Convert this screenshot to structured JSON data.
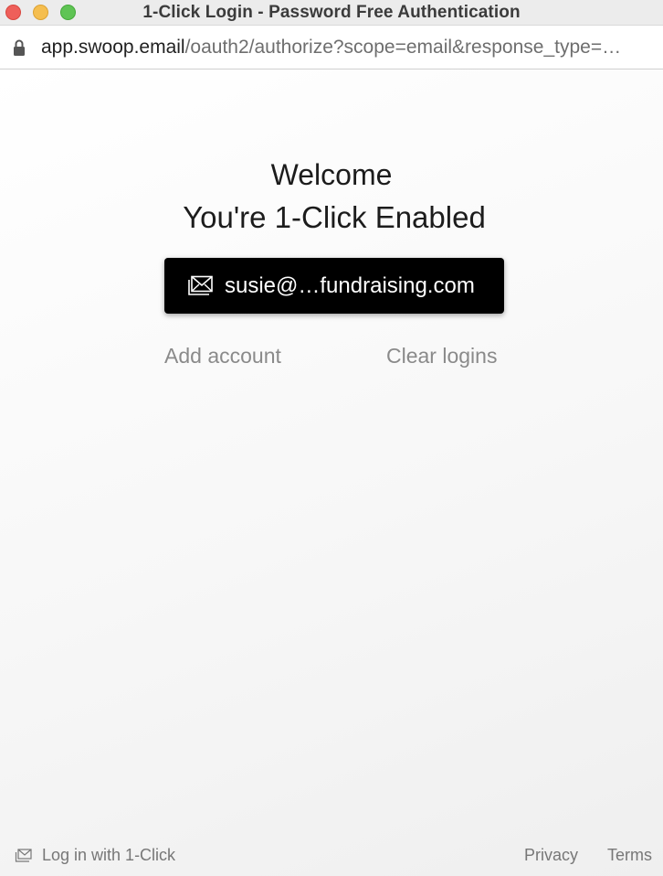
{
  "window": {
    "title": "1-Click Login - Password Free Authentication"
  },
  "urlbar": {
    "host": "app.swoop.email",
    "path": "/oauth2/authorize?scope=email&response_type=…"
  },
  "main": {
    "welcome": "Welcome",
    "subtitle": "You're 1-Click Enabled",
    "account_label": "susie@…fundraising.com",
    "add_account": "Add account",
    "clear_logins": "Clear logins"
  },
  "footer": {
    "login_with": "Log in with 1-Click",
    "privacy": "Privacy",
    "terms": "Terms"
  },
  "colors": {
    "button_bg": "#000000",
    "link_gray": "#8a8a8a",
    "traffic_close": "#ee5f5a",
    "traffic_minimize": "#f5be4f",
    "traffic_maximize": "#5fc454"
  },
  "icons": {
    "lock": "lock-icon",
    "account": "envelope-icon",
    "footer": "envelope-icon"
  }
}
